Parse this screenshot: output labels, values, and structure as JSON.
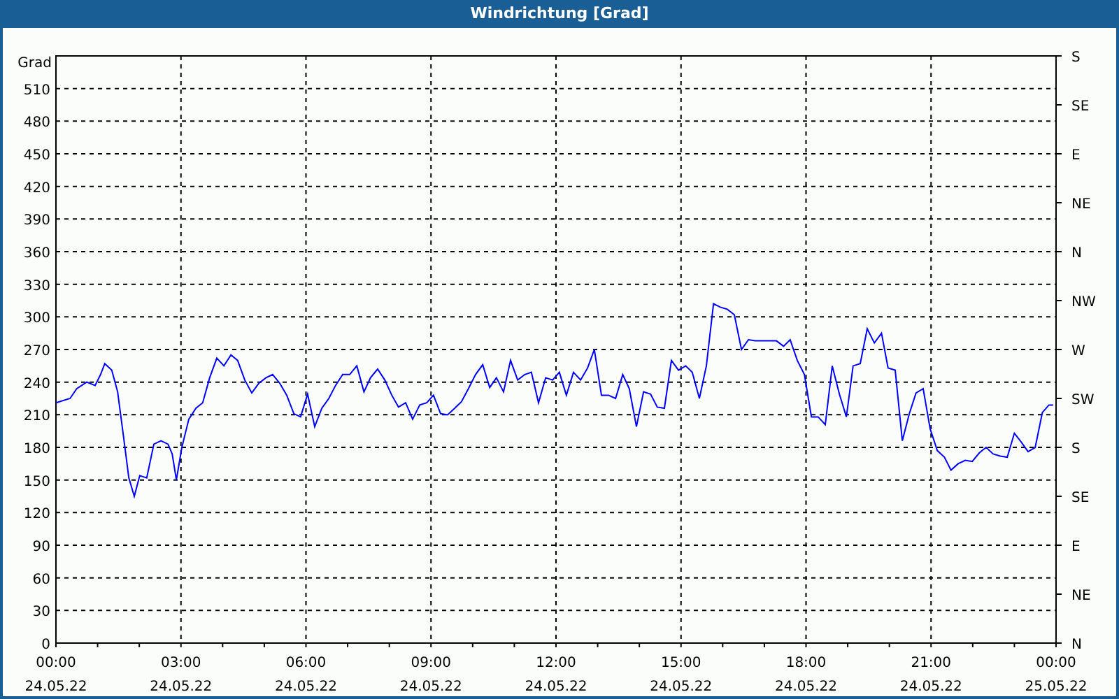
{
  "window": {
    "title": "Windrichtung [Grad]"
  },
  "chart": {
    "unit_label": "Grad",
    "date_labels": [
      "24.05.22",
      "24.05.22",
      "24.05.22",
      "24.05.22",
      "24.05.22",
      "24.05.22",
      "24.05.22",
      "24.05.22",
      "25.05.22"
    ],
    "right_axis_labels": [
      "S",
      "SE",
      "E",
      "NE",
      "N",
      "NW",
      "W",
      "SW",
      "S",
      "SE",
      "E",
      "NE",
      "N"
    ],
    "chart_data": {
      "type": "line",
      "grid": true,
      "xlim": [
        0,
        24
      ],
      "ylim": [
        0,
        540
      ],
      "xticks": [
        {
          "value": 0,
          "label": "00:00"
        },
        {
          "value": 3,
          "label": "03:00"
        },
        {
          "value": 6,
          "label": "06:00"
        },
        {
          "value": 9,
          "label": "09:00"
        },
        {
          "value": 12,
          "label": "12:00"
        },
        {
          "value": 15,
          "label": "15:00"
        },
        {
          "value": 18,
          "label": "18:00"
        },
        {
          "value": 21,
          "label": "21:00"
        },
        {
          "value": 24,
          "label": "00:00"
        }
      ],
      "yticks": [
        0,
        30,
        60,
        90,
        120,
        150,
        180,
        210,
        240,
        270,
        300,
        330,
        360,
        390,
        420,
        450,
        480,
        510
      ],
      "x": [
        0,
        0.34,
        0.5,
        0.74,
        0.94,
        1.07,
        1.17,
        1.34,
        1.48,
        1.61,
        1.75,
        1.88,
        2.01,
        2.18,
        2.35,
        2.52,
        2.69,
        2.79,
        2.89,
        3.02,
        3.19,
        3.36,
        3.52,
        3.69,
        3.86,
        4.03,
        4.2,
        4.36,
        4.53,
        4.7,
        4.87,
        5.04,
        5.2,
        5.37,
        5.54,
        5.71,
        5.87,
        6.04,
        6.21,
        6.38,
        6.55,
        6.71,
        6.88,
        7.05,
        7.22,
        7.39,
        7.55,
        7.72,
        7.89,
        8.06,
        8.22,
        8.39,
        8.56,
        8.73,
        8.9,
        9.06,
        9.23,
        9.4,
        9.57,
        9.73,
        9.9,
        10.07,
        10.24,
        10.41,
        10.57,
        10.74,
        10.91,
        11.08,
        11.25,
        11.41,
        11.58,
        11.75,
        11.92,
        12.08,
        12.25,
        12.42,
        12.59,
        12.76,
        12.92,
        13.09,
        13.26,
        13.43,
        13.6,
        13.76,
        13.93,
        14.1,
        14.27,
        14.43,
        14.6,
        14.77,
        14.94,
        15.11,
        15.27,
        15.44,
        15.61,
        15.78,
        15.94,
        16.11,
        16.28,
        16.45,
        16.62,
        16.78,
        16.95,
        17.12,
        17.29,
        17.46,
        17.62,
        17.79,
        17.96,
        18.13,
        18.29,
        18.46,
        18.63,
        18.8,
        18.97,
        19.13,
        19.3,
        19.47,
        19.64,
        19.81,
        19.97,
        20.14,
        20.31,
        20.48,
        20.64,
        20.81,
        20.98,
        21.15,
        21.32,
        21.48,
        21.65,
        21.82,
        21.99,
        22.16,
        22.32,
        22.49,
        22.66,
        22.83,
        23,
        23.16,
        23.33,
        23.5,
        23.67,
        23.83,
        23.93
      ],
      "series": [
        {
          "color": "#0000ff",
          "values": [
            221,
            225,
            234,
            240,
            237,
            247,
            257,
            251,
            231,
            193,
            152,
            135,
            154,
            152,
            183,
            186,
            183,
            174,
            150,
            180,
            206,
            216,
            221,
            244,
            262,
            255,
            265,
            260,
            242,
            230,
            239,
            244,
            247,
            239,
            228,
            211,
            208,
            229,
            199,
            216,
            225,
            237,
            247,
            247,
            255,
            231,
            244,
            252,
            242,
            228,
            217,
            221,
            206,
            219,
            221,
            228,
            211,
            210,
            216,
            222,
            234,
            247,
            256,
            235,
            244,
            231,
            260,
            242,
            247,
            249,
            221,
            244,
            242,
            249,
            228,
            249,
            242,
            253,
            270,
            228,
            228,
            225,
            247,
            234,
            199,
            231,
            229,
            217,
            216,
            260,
            251,
            255,
            249,
            225,
            255,
            312,
            309,
            307,
            302,
            270,
            279,
            278,
            278,
            278,
            278,
            273,
            279,
            260,
            247,
            208,
            208,
            201,
            255,
            229,
            208,
            255,
            257,
            289,
            276,
            285,
            253,
            251,
            186,
            211,
            230,
            234,
            197,
            177,
            171,
            159,
            165,
            168,
            167,
            175,
            180,
            174,
            172,
            171,
            193,
            185,
            176,
            180,
            212,
            219,
            219
          ]
        }
      ]
    }
  }
}
